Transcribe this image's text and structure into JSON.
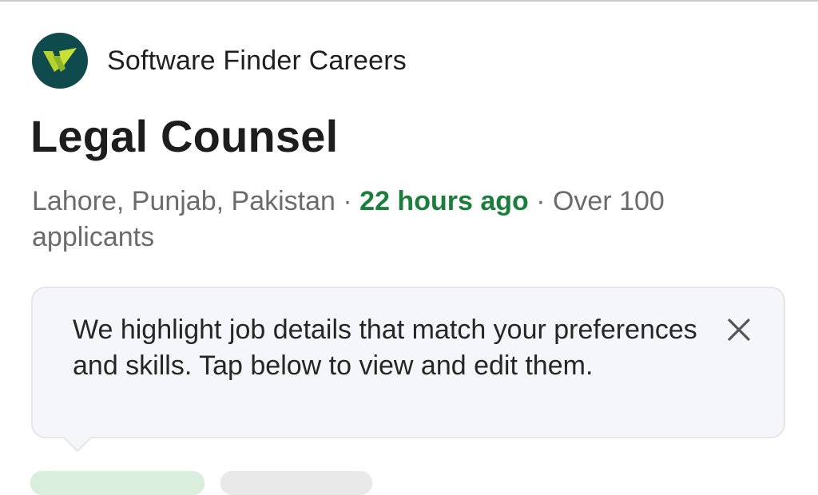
{
  "company": {
    "name": "Software Finder Careers",
    "logo_icon": "software-finder-logo",
    "logo_bg": "#0f4a4c",
    "logo_accent": "#b7d22b"
  },
  "job": {
    "title": "Legal Counsel",
    "location": "Lahore, Punjab, Pakistan",
    "separator": " · ",
    "posted": "22 hours ago",
    "applicants": "Over 100 applicants"
  },
  "tip": {
    "text": "We highlight job details that match your preferences and skills. Tap below to view and edit them.",
    "close_icon": "close-icon"
  },
  "colors": {
    "posted_green": "#1b7f3b",
    "muted_text": "#6b6b6b",
    "card_bg": "#f4f6f9"
  }
}
